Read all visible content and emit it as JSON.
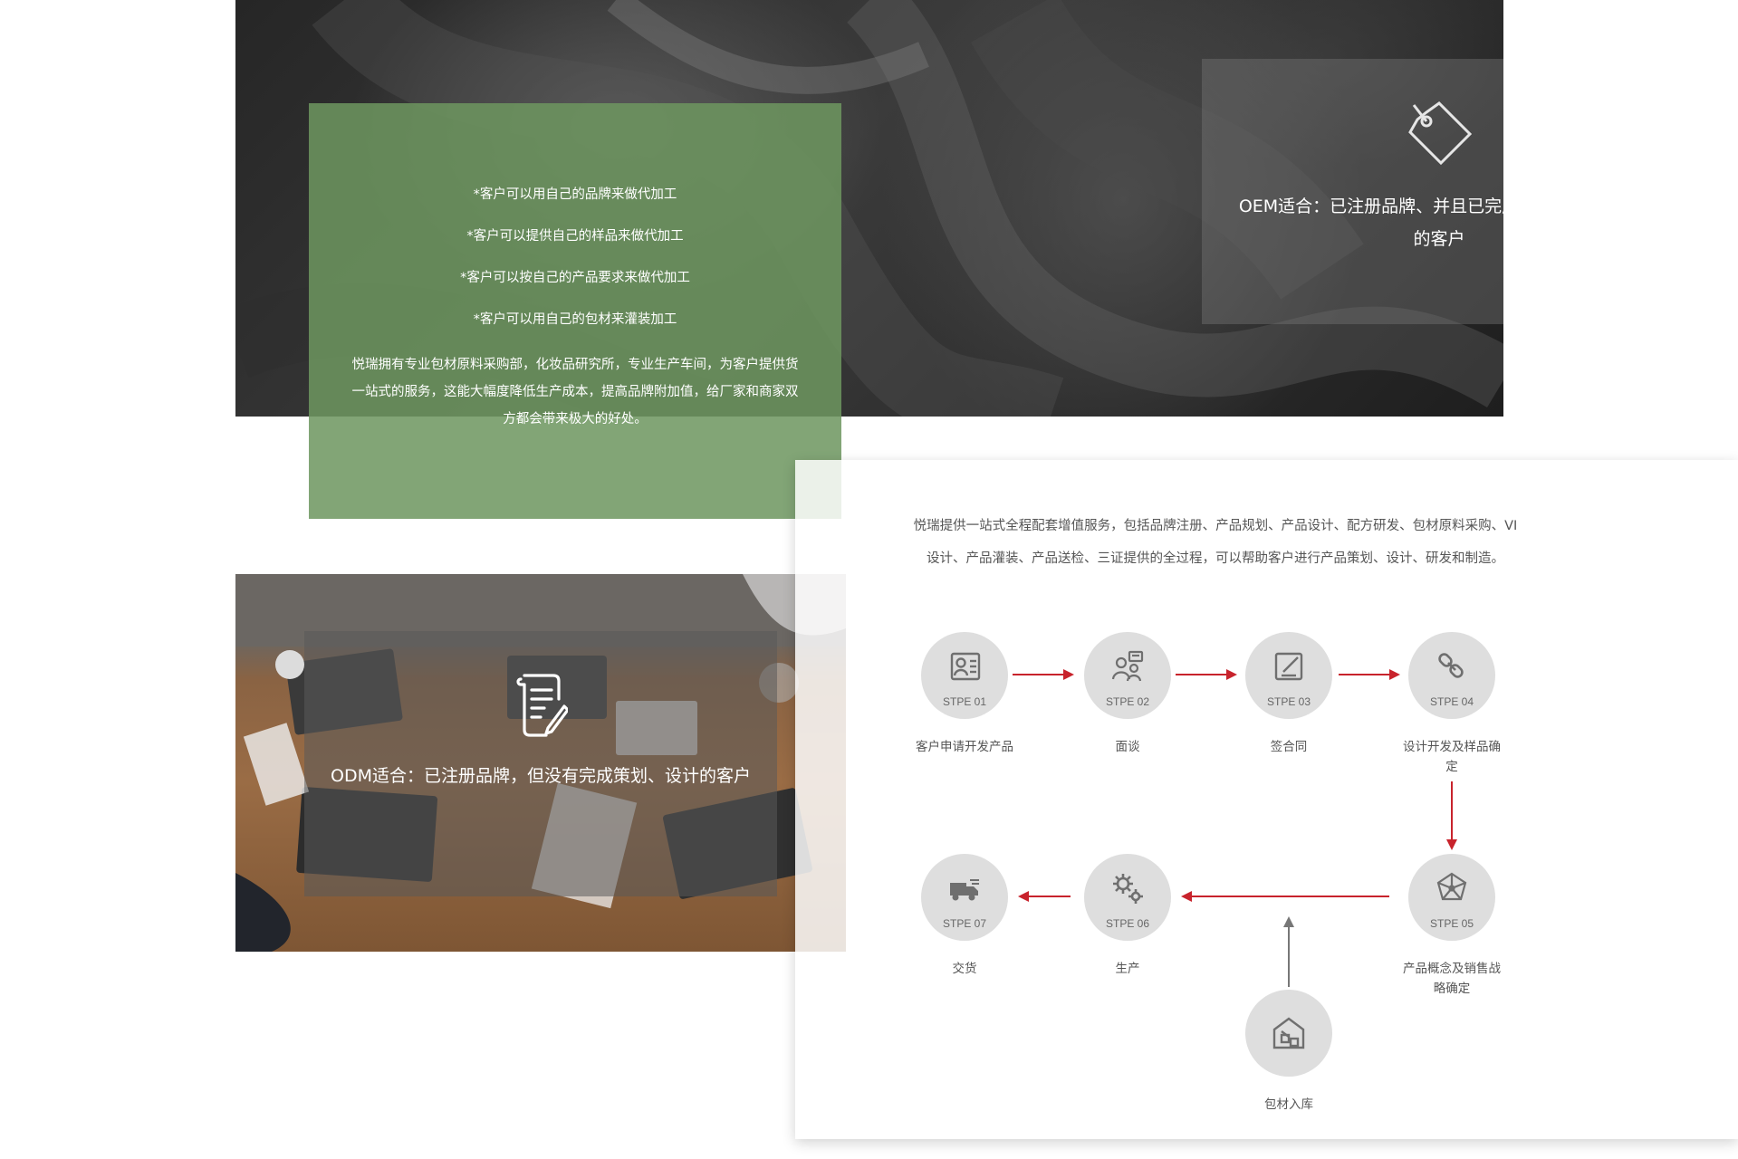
{
  "colors": {
    "green_card": "#6d9660",
    "arrow_red": "#c8232c",
    "arrow_gray": "#777777",
    "step_circle": "#dedede"
  },
  "oem": {
    "icon": "price-tag-icon",
    "text": "OEM适合：已注册品牌、并且已完成策划和产品设计的客户"
  },
  "green_card": {
    "bullets": [
      "*客户可以用自己的品牌来做代加工",
      "*客户可以提供自己的样品来做代加工",
      "*客户可以按自己的产品要求来做代加工",
      "*客户可以用自己的包材来灌装加工"
    ],
    "paragraph": "悦瑞拥有专业包材原料采购部，化妆品研究所，专业生产车间，为客户提供货一站式的服务，这能大幅度降低生产成本，提高品牌附加值，给厂家和商家双方都会带来极大的好处。"
  },
  "odm": {
    "icon": "document-edit-icon",
    "text": "ODM适合：已注册品牌，但没有完成策划、设计的客户"
  },
  "process": {
    "intro": "悦瑞提供一站式全程配套增值服务，包括品牌注册、产品规划、产品设计、配方研发、包材原料采购、VI设计、产品灌装、产品送检、三证提供的全过程，可以帮助客户进行产品策划、设计、研发和制造。",
    "steps": [
      {
        "num": "STPE 01",
        "label": "客户申请开发产品",
        "icon": "id-card-icon"
      },
      {
        "num": "STPE 02",
        "label": "面谈",
        "icon": "meeting-icon"
      },
      {
        "num": "STPE 03",
        "label": "签合同",
        "icon": "sign-contract-icon"
      },
      {
        "num": "STPE 04",
        "label": "设计开发及样品确定",
        "icon": "chain-link-icon"
      },
      {
        "num": "STPE 05",
        "label": "产品概念及销售战略确定",
        "icon": "network-icon"
      },
      {
        "num": "STPE 06",
        "label": "生产",
        "icon": "gears-icon"
      },
      {
        "num": "STPE 07",
        "label": "交货",
        "icon": "delivery-truck-icon"
      }
    ],
    "extra_step": {
      "label": "包材入库",
      "icon": "warehouse-icon"
    }
  }
}
